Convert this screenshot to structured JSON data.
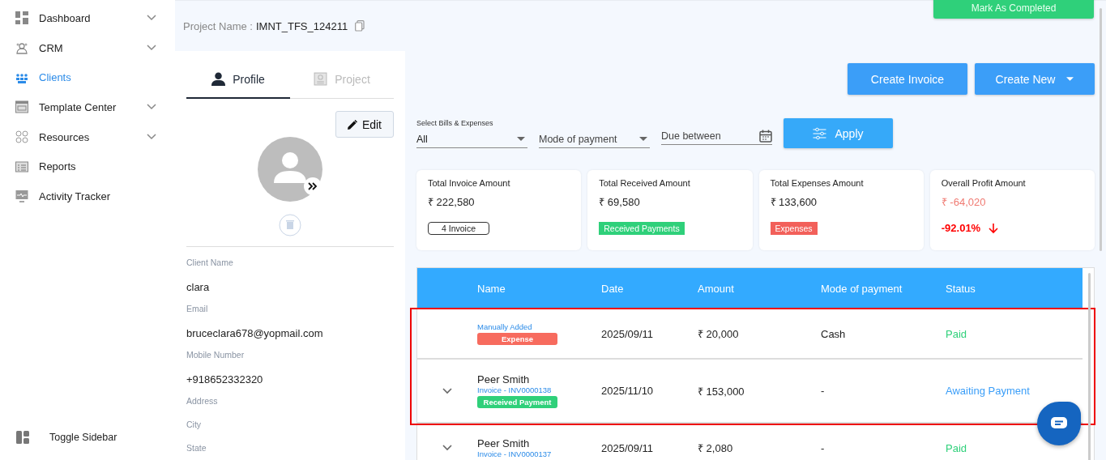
{
  "sidebar": {
    "items": [
      {
        "label": "Dashboard",
        "kind": "grid",
        "selected": false,
        "expandable": true
      },
      {
        "label": "CRM",
        "kind": "crm",
        "selected": false,
        "expandable": true
      },
      {
        "label": "Clients",
        "kind": "people",
        "selected": true,
        "expandable": false
      },
      {
        "label": "Template Center",
        "kind": "template",
        "selected": false,
        "expandable": true
      },
      {
        "label": "Resources",
        "kind": "resources",
        "selected": false,
        "expandable": true
      },
      {
        "label": "Reports",
        "kind": "reports",
        "selected": false,
        "expandable": false
      },
      {
        "label": "Activity Tracker",
        "kind": "monitor",
        "selected": false,
        "expandable": false
      }
    ],
    "toggle": "Toggle Sidebar"
  },
  "project": {
    "label": "Project Name :",
    "value": "IMNT_TFS_124211"
  },
  "mark_completed": "Mark As Completed",
  "tabs": [
    {
      "label": "Profile",
      "selected": true
    },
    {
      "label": "Project",
      "selected": false
    }
  ],
  "edit_button": "Edit",
  "fields": [
    {
      "label": "Client Name",
      "value": "clara"
    },
    {
      "label": "Email",
      "value": "bruceclara678@yopmail.com"
    },
    {
      "label": "Mobile Number",
      "value": "+918652332320"
    },
    {
      "label": "Address"
    },
    {
      "label": "City"
    },
    {
      "label": "State"
    }
  ],
  "actions": {
    "create_invoice": "Create Invoice",
    "create_new": "Create New"
  },
  "filters": {
    "select_label": "Select Bills & Expenses",
    "select_value": "All",
    "mode_placeholder": "Mode of payment",
    "due_placeholder": "Due between",
    "apply": "Apply"
  },
  "cards": [
    {
      "title": "Total Invoice Amount",
      "amount": "₹ 222,580",
      "kind": "outline",
      "badge": "4 Invoice"
    },
    {
      "title": "Total Received Amount",
      "amount": "₹ 69,580",
      "kind": "success",
      "badge": "Received Payments"
    },
    {
      "title": "Total Expenses Amount",
      "amount": "₹ 133,600",
      "kind": "danger",
      "badge": "Expenses"
    },
    {
      "title": "Overall Profit Amount",
      "amount": "₹ -64,020",
      "kind": "trend",
      "badge": "-92.01%"
    }
  ],
  "table": {
    "columns": [
      "Name",
      "Date",
      "Amount",
      "Mode of payment",
      "Status"
    ],
    "rows": [
      {
        "expandable": false,
        "highlighted": true,
        "source": "Manually Added",
        "badge": {
          "text": "Expense",
          "color": "#f76b5e"
        },
        "date": "2025/09/11",
        "amount": "₹ 20,000",
        "mode": "Cash",
        "status": {
          "text": "Paid",
          "color": "#2fd07a"
        }
      },
      {
        "expandable": true,
        "highlighted": true,
        "name": "Peer Smith",
        "source": "Invoice - INV0000138",
        "badge": {
          "text": "Received Payment",
          "color": "#2fd07a"
        },
        "date": "2025/11/10",
        "amount": "₹ 153,000",
        "mode": "-",
        "status": {
          "text": "Awaiting Payment",
          "color": "#3b9ef8"
        }
      },
      {
        "expandable": true,
        "highlighted": false,
        "name": "Peer Smith",
        "source": "Invoice - INV0000137",
        "date": "2025/09/11",
        "amount": "₹ 2,080",
        "mode": "-",
        "status": {
          "text": "Paid",
          "color": "#2fd07a"
        }
      }
    ]
  }
}
